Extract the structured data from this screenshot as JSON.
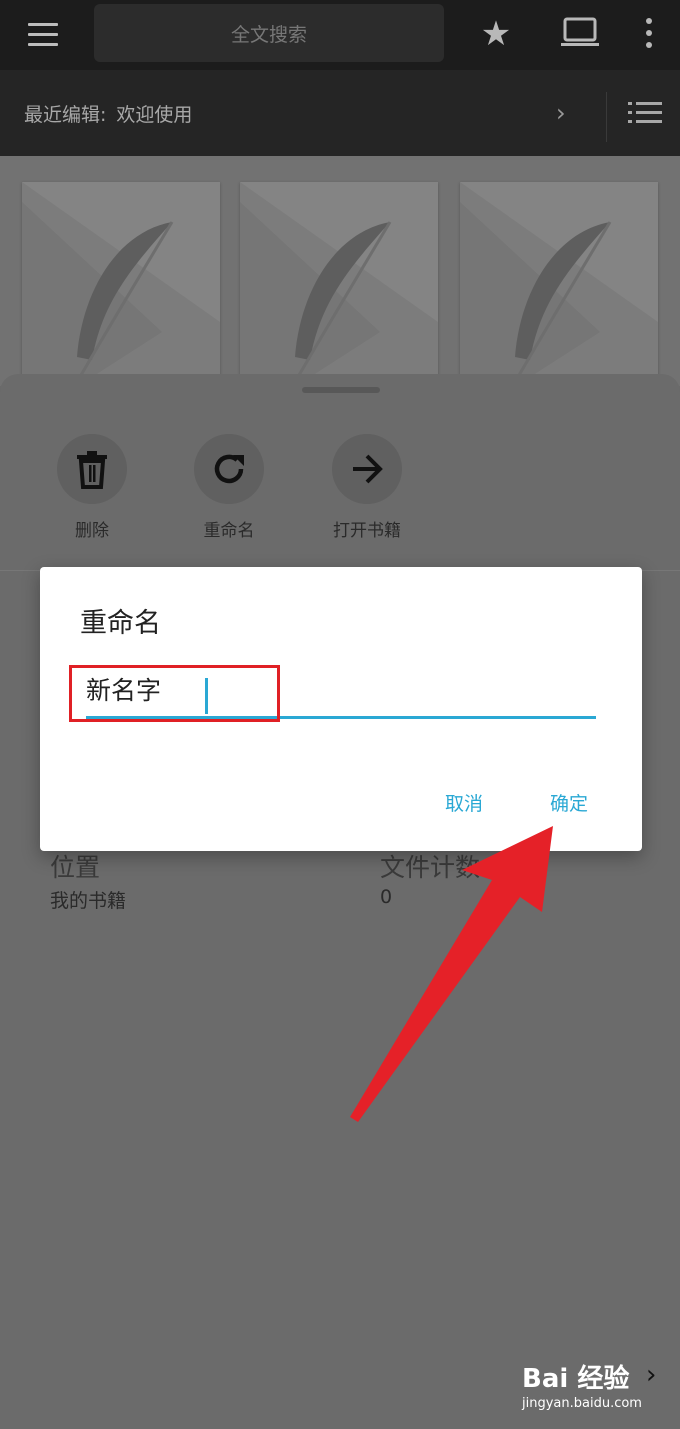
{
  "topbar": {
    "search_placeholder": "全文搜索",
    "menu_icon": "hamburger-menu-icon",
    "star_icon": "star-icon",
    "laptop_icon": "laptop-icon",
    "more_icon": "more-vert-icon"
  },
  "recent": {
    "label": "最近编辑:",
    "value": "欢迎使用",
    "chevron_icon": "chevron-right-icon",
    "list_icon": "list-icon"
  },
  "actions": [
    {
      "label": "删除",
      "icon": "trash-icon"
    },
    {
      "label": "重命名",
      "icon": "refresh-icon"
    },
    {
      "label": "打开书籍",
      "icon": "arrow-right-icon"
    }
  ],
  "info": {
    "location_label": "位置",
    "location_value": "我的书籍",
    "count_label": "文件计数",
    "count_value": "0"
  },
  "dialog": {
    "title": "重命名",
    "input_value": "新名字",
    "cancel_label": "取消",
    "confirm_label": "确定"
  },
  "watermark": {
    "brand": "Bai 经验",
    "url": "jingyan.baidu.com"
  },
  "colors": {
    "accent": "#2aa8d4",
    "annotation": "#e02025",
    "topbar": "#1c1c1c"
  }
}
